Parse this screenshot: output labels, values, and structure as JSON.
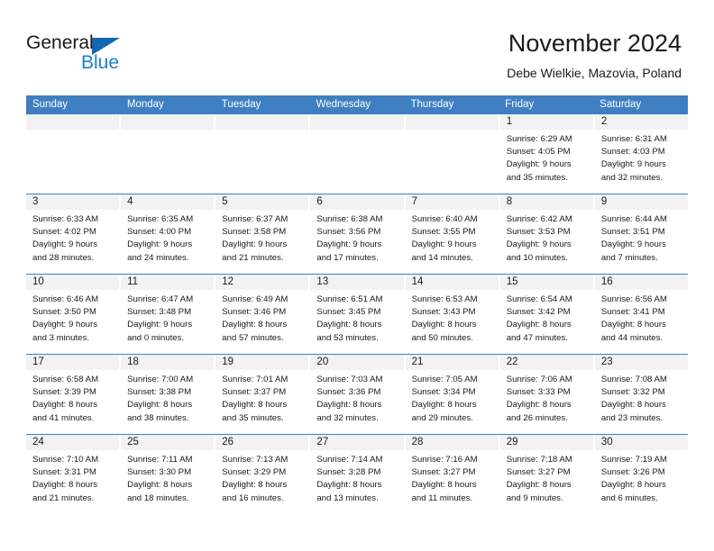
{
  "brand": {
    "name_part1": "General",
    "name_part2": "Blue"
  },
  "header": {
    "title": "November 2024",
    "subtitle": "Debe Wielkie, Mazovia, Poland"
  },
  "colors": {
    "header_blue": "#3f7fc1",
    "logo_blue": "#1a7fd4",
    "daynum_band": "#f2f2f2",
    "text": "#1a1a1a"
  },
  "weekday_headers": [
    "Sunday",
    "Monday",
    "Tuesday",
    "Wednesday",
    "Thursday",
    "Friday",
    "Saturday"
  ],
  "weeks": [
    [
      {
        "day": "",
        "empty": true,
        "sunrise": "",
        "sunset": "",
        "daylight_line1": "",
        "daylight_line2": ""
      },
      {
        "day": "",
        "empty": true,
        "sunrise": "",
        "sunset": "",
        "daylight_line1": "",
        "daylight_line2": ""
      },
      {
        "day": "",
        "empty": true,
        "sunrise": "",
        "sunset": "",
        "daylight_line1": "",
        "daylight_line2": ""
      },
      {
        "day": "",
        "empty": true,
        "sunrise": "",
        "sunset": "",
        "daylight_line1": "",
        "daylight_line2": ""
      },
      {
        "day": "",
        "empty": true,
        "sunrise": "",
        "sunset": "",
        "daylight_line1": "",
        "daylight_line2": ""
      },
      {
        "day": "1",
        "empty": false,
        "sunrise": "Sunrise: 6:29 AM",
        "sunset": "Sunset: 4:05 PM",
        "daylight_line1": "Daylight: 9 hours",
        "daylight_line2": "and 35 minutes."
      },
      {
        "day": "2",
        "empty": false,
        "sunrise": "Sunrise: 6:31 AM",
        "sunset": "Sunset: 4:03 PM",
        "daylight_line1": "Daylight: 9 hours",
        "daylight_line2": "and 32 minutes."
      }
    ],
    [
      {
        "day": "3",
        "empty": false,
        "sunrise": "Sunrise: 6:33 AM",
        "sunset": "Sunset: 4:02 PM",
        "daylight_line1": "Daylight: 9 hours",
        "daylight_line2": "and 28 minutes."
      },
      {
        "day": "4",
        "empty": false,
        "sunrise": "Sunrise: 6:35 AM",
        "sunset": "Sunset: 4:00 PM",
        "daylight_line1": "Daylight: 9 hours",
        "daylight_line2": "and 24 minutes."
      },
      {
        "day": "5",
        "empty": false,
        "sunrise": "Sunrise: 6:37 AM",
        "sunset": "Sunset: 3:58 PM",
        "daylight_line1": "Daylight: 9 hours",
        "daylight_line2": "and 21 minutes."
      },
      {
        "day": "6",
        "empty": false,
        "sunrise": "Sunrise: 6:38 AM",
        "sunset": "Sunset: 3:56 PM",
        "daylight_line1": "Daylight: 9 hours",
        "daylight_line2": "and 17 minutes."
      },
      {
        "day": "7",
        "empty": false,
        "sunrise": "Sunrise: 6:40 AM",
        "sunset": "Sunset: 3:55 PM",
        "daylight_line1": "Daylight: 9 hours",
        "daylight_line2": "and 14 minutes."
      },
      {
        "day": "8",
        "empty": false,
        "sunrise": "Sunrise: 6:42 AM",
        "sunset": "Sunset: 3:53 PM",
        "daylight_line1": "Daylight: 9 hours",
        "daylight_line2": "and 10 minutes."
      },
      {
        "day": "9",
        "empty": false,
        "sunrise": "Sunrise: 6:44 AM",
        "sunset": "Sunset: 3:51 PM",
        "daylight_line1": "Daylight: 9 hours",
        "daylight_line2": "and 7 minutes."
      }
    ],
    [
      {
        "day": "10",
        "empty": false,
        "sunrise": "Sunrise: 6:46 AM",
        "sunset": "Sunset: 3:50 PM",
        "daylight_line1": "Daylight: 9 hours",
        "daylight_line2": "and 3 minutes."
      },
      {
        "day": "11",
        "empty": false,
        "sunrise": "Sunrise: 6:47 AM",
        "sunset": "Sunset: 3:48 PM",
        "daylight_line1": "Daylight: 9 hours",
        "daylight_line2": "and 0 minutes."
      },
      {
        "day": "12",
        "empty": false,
        "sunrise": "Sunrise: 6:49 AM",
        "sunset": "Sunset: 3:46 PM",
        "daylight_line1": "Daylight: 8 hours",
        "daylight_line2": "and 57 minutes."
      },
      {
        "day": "13",
        "empty": false,
        "sunrise": "Sunrise: 6:51 AM",
        "sunset": "Sunset: 3:45 PM",
        "daylight_line1": "Daylight: 8 hours",
        "daylight_line2": "and 53 minutes."
      },
      {
        "day": "14",
        "empty": false,
        "sunrise": "Sunrise: 6:53 AM",
        "sunset": "Sunset: 3:43 PM",
        "daylight_line1": "Daylight: 8 hours",
        "daylight_line2": "and 50 minutes."
      },
      {
        "day": "15",
        "empty": false,
        "sunrise": "Sunrise: 6:54 AM",
        "sunset": "Sunset: 3:42 PM",
        "daylight_line1": "Daylight: 8 hours",
        "daylight_line2": "and 47 minutes."
      },
      {
        "day": "16",
        "empty": false,
        "sunrise": "Sunrise: 6:56 AM",
        "sunset": "Sunset: 3:41 PM",
        "daylight_line1": "Daylight: 8 hours",
        "daylight_line2": "and 44 minutes."
      }
    ],
    [
      {
        "day": "17",
        "empty": false,
        "sunrise": "Sunrise: 6:58 AM",
        "sunset": "Sunset: 3:39 PM",
        "daylight_line1": "Daylight: 8 hours",
        "daylight_line2": "and 41 minutes."
      },
      {
        "day": "18",
        "empty": false,
        "sunrise": "Sunrise: 7:00 AM",
        "sunset": "Sunset: 3:38 PM",
        "daylight_line1": "Daylight: 8 hours",
        "daylight_line2": "and 38 minutes."
      },
      {
        "day": "19",
        "empty": false,
        "sunrise": "Sunrise: 7:01 AM",
        "sunset": "Sunset: 3:37 PM",
        "daylight_line1": "Daylight: 8 hours",
        "daylight_line2": "and 35 minutes."
      },
      {
        "day": "20",
        "empty": false,
        "sunrise": "Sunrise: 7:03 AM",
        "sunset": "Sunset: 3:36 PM",
        "daylight_line1": "Daylight: 8 hours",
        "daylight_line2": "and 32 minutes."
      },
      {
        "day": "21",
        "empty": false,
        "sunrise": "Sunrise: 7:05 AM",
        "sunset": "Sunset: 3:34 PM",
        "daylight_line1": "Daylight: 8 hours",
        "daylight_line2": "and 29 minutes."
      },
      {
        "day": "22",
        "empty": false,
        "sunrise": "Sunrise: 7:06 AM",
        "sunset": "Sunset: 3:33 PM",
        "daylight_line1": "Daylight: 8 hours",
        "daylight_line2": "and 26 minutes."
      },
      {
        "day": "23",
        "empty": false,
        "sunrise": "Sunrise: 7:08 AM",
        "sunset": "Sunset: 3:32 PM",
        "daylight_line1": "Daylight: 8 hours",
        "daylight_line2": "and 23 minutes."
      }
    ],
    [
      {
        "day": "24",
        "empty": false,
        "sunrise": "Sunrise: 7:10 AM",
        "sunset": "Sunset: 3:31 PM",
        "daylight_line1": "Daylight: 8 hours",
        "daylight_line2": "and 21 minutes."
      },
      {
        "day": "25",
        "empty": false,
        "sunrise": "Sunrise: 7:11 AM",
        "sunset": "Sunset: 3:30 PM",
        "daylight_line1": "Daylight: 8 hours",
        "daylight_line2": "and 18 minutes."
      },
      {
        "day": "26",
        "empty": false,
        "sunrise": "Sunrise: 7:13 AM",
        "sunset": "Sunset: 3:29 PM",
        "daylight_line1": "Daylight: 8 hours",
        "daylight_line2": "and 16 minutes."
      },
      {
        "day": "27",
        "empty": false,
        "sunrise": "Sunrise: 7:14 AM",
        "sunset": "Sunset: 3:28 PM",
        "daylight_line1": "Daylight: 8 hours",
        "daylight_line2": "and 13 minutes."
      },
      {
        "day": "28",
        "empty": false,
        "sunrise": "Sunrise: 7:16 AM",
        "sunset": "Sunset: 3:27 PM",
        "daylight_line1": "Daylight: 8 hours",
        "daylight_line2": "and 11 minutes."
      },
      {
        "day": "29",
        "empty": false,
        "sunrise": "Sunrise: 7:18 AM",
        "sunset": "Sunset: 3:27 PM",
        "daylight_line1": "Daylight: 8 hours",
        "daylight_line2": "and 9 minutes."
      },
      {
        "day": "30",
        "empty": false,
        "sunrise": "Sunrise: 7:19 AM",
        "sunset": "Sunset: 3:26 PM",
        "daylight_line1": "Daylight: 8 hours",
        "daylight_line2": "and 6 minutes."
      }
    ]
  ]
}
